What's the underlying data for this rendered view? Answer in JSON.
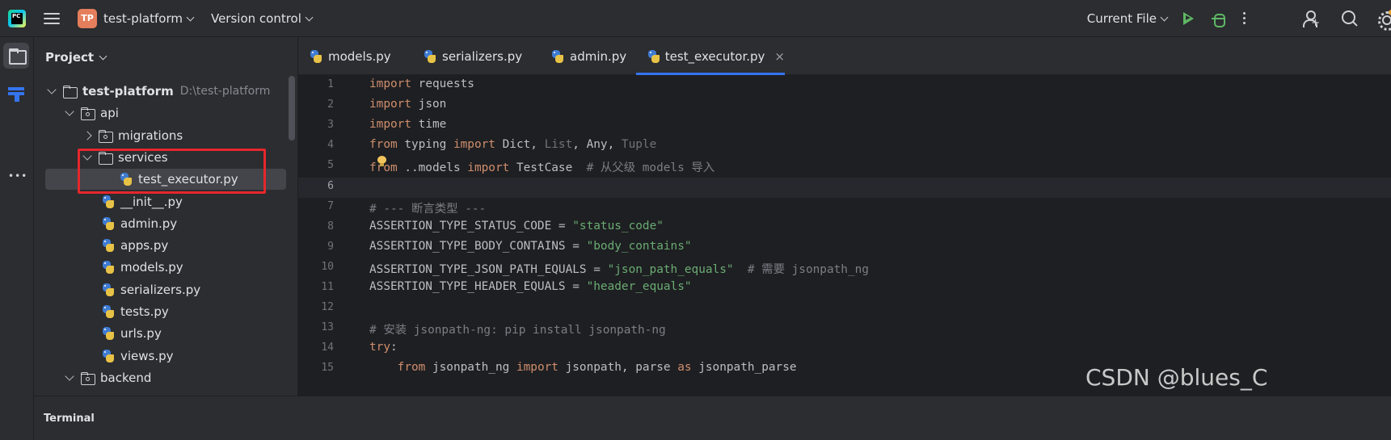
{
  "topbar": {
    "logo_text": "PC",
    "project_badge": "TP",
    "project_name": "test-platform",
    "vcs_label": "Version control",
    "run_config": "Current File"
  },
  "panel": {
    "title": "Project"
  },
  "tree": [
    {
      "label": "test-platform",
      "hint": "D:\\test-platform",
      "type": "folder",
      "expanded": true,
      "bold": true
    },
    {
      "label": "api",
      "type": "package",
      "expanded": true
    },
    {
      "label": "migrations",
      "type": "package",
      "expanded": false
    },
    {
      "label": "services",
      "type": "folder",
      "expanded": true
    },
    {
      "label": "test_executor.py",
      "type": "python",
      "selected": true
    },
    {
      "label": "__init__.py",
      "type": "python"
    },
    {
      "label": "admin.py",
      "type": "python"
    },
    {
      "label": "apps.py",
      "type": "python"
    },
    {
      "label": "models.py",
      "type": "python"
    },
    {
      "label": "serializers.py",
      "type": "python"
    },
    {
      "label": "tests.py",
      "type": "python"
    },
    {
      "label": "urls.py",
      "type": "python"
    },
    {
      "label": "views.py",
      "type": "python"
    },
    {
      "label": "backend",
      "type": "package",
      "expanded": true
    }
  ],
  "tabs": [
    {
      "label": "models.py",
      "active": false
    },
    {
      "label": "serializers.py",
      "active": false
    },
    {
      "label": "admin.py",
      "active": false
    },
    {
      "label": "test_executor.py",
      "active": true,
      "close": "×"
    }
  ],
  "editor": {
    "current_line": 6,
    "lines": [
      {
        "n": "1",
        "tokens": [
          [
            "kw",
            "import"
          ],
          [
            "",
            "requests"
          ]
        ]
      },
      {
        "n": "2",
        "tokens": [
          [
            "kw",
            "import"
          ],
          [
            "",
            "json"
          ]
        ]
      },
      {
        "n": "3",
        "tokens": [
          [
            "kw",
            "import"
          ],
          [
            "",
            "time"
          ]
        ]
      },
      {
        "n": "4",
        "tokens": [
          [
            "kw",
            "from"
          ],
          [
            "",
            " typing "
          ],
          [
            "kw",
            "import"
          ],
          [
            "",
            " Dict, "
          ],
          [
            "dim",
            "List"
          ],
          [
            "",
            ", Any, "
          ],
          [
            "dim",
            "Tuple"
          ]
        ]
      },
      {
        "n": "5",
        "tokens": [
          [
            "kw",
            "from"
          ],
          [
            "",
            " ..models "
          ],
          [
            "kw",
            "import"
          ],
          [
            "",
            " TestCase  "
          ],
          [
            "cm",
            "# 从父级 models 导入"
          ]
        ]
      },
      {
        "n": "6",
        "tokens": []
      },
      {
        "n": "7",
        "tokens": [
          [
            "cm",
            "# --- 断言类型 ---"
          ]
        ]
      },
      {
        "n": "8",
        "tokens": [
          [
            "",
            "ASSERTION_TYPE_STATUS_CODE = "
          ],
          [
            "str",
            "\"status_code\""
          ]
        ]
      },
      {
        "n": "9",
        "tokens": [
          [
            "",
            "ASSERTION_TYPE_BODY_CONTAINS = "
          ],
          [
            "str",
            "\"body_contains\""
          ]
        ]
      },
      {
        "n": "10",
        "tokens": [
          [
            "",
            "ASSERTION_TYPE_JSON_PATH_EQUALS = "
          ],
          [
            "str",
            "\"json_path_equals\""
          ],
          [
            "",
            "  "
          ],
          [
            "cm",
            "# 需要 jsonpath_ng"
          ]
        ]
      },
      {
        "n": "11",
        "tokens": [
          [
            "",
            "ASSERTION_TYPE_HEADER_EQUALS = "
          ],
          [
            "str",
            "\"header_equals\""
          ]
        ]
      },
      {
        "n": "12",
        "tokens": []
      },
      {
        "n": "13",
        "tokens": [
          [
            "cm",
            "# 安装 jsonpath-ng: pip install jsonpath-ng"
          ]
        ]
      },
      {
        "n": "14",
        "tokens": [
          [
            "kw",
            "try"
          ],
          [
            "",
            ":"
          ]
        ]
      },
      {
        "n": "15",
        "tokens": [
          [
            "",
            "    "
          ],
          [
            "kw",
            "from"
          ],
          [
            "",
            " jsonpath_ng "
          ],
          [
            "kw",
            "import"
          ],
          [
            "",
            " jsonpath, parse "
          ],
          [
            "kw",
            "as"
          ],
          [
            "",
            " jsonpath_parse"
          ]
        ]
      }
    ]
  },
  "bottom": {
    "label": "Terminal"
  },
  "watermark": "CSDN @blues_C"
}
